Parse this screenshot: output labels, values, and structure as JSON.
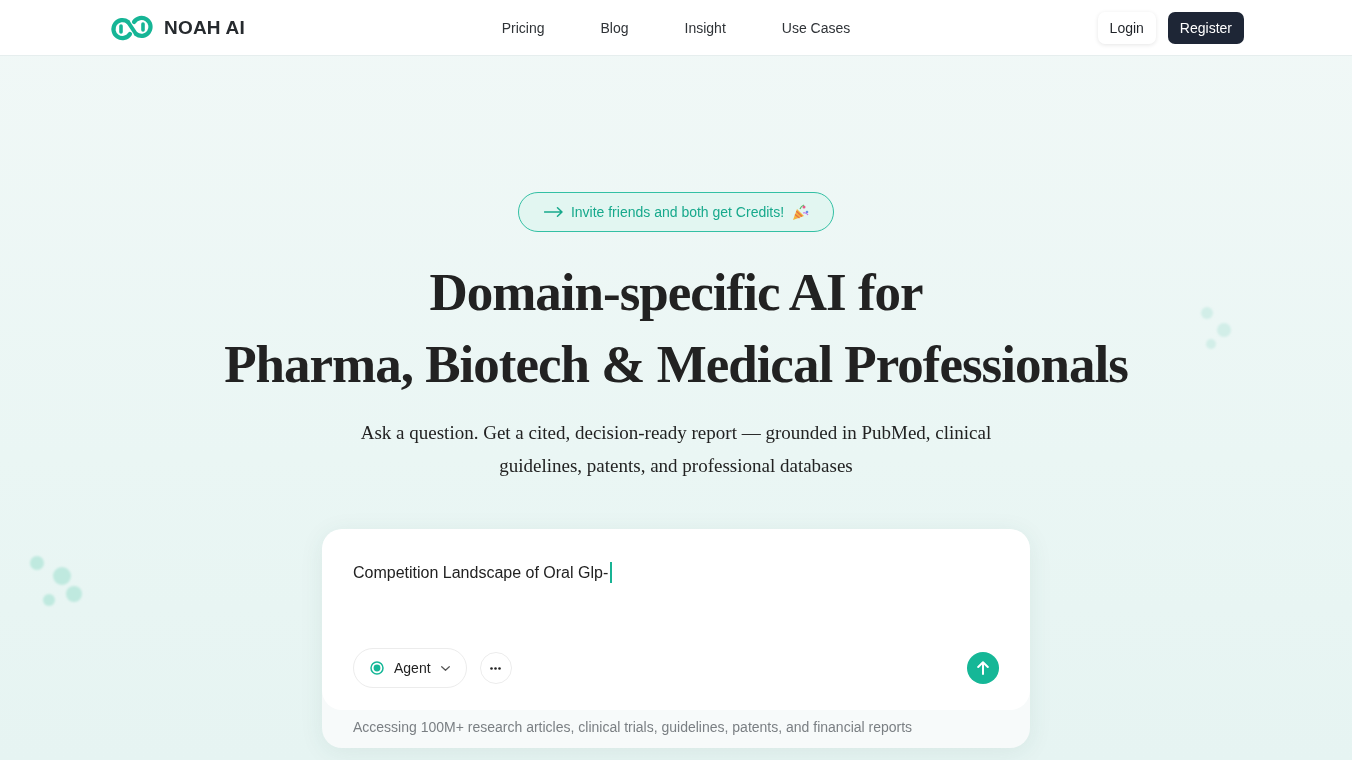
{
  "header": {
    "logo": {
      "text": "NOAH AI"
    },
    "nav": [
      {
        "label": "Pricing"
      },
      {
        "label": "Blog"
      },
      {
        "label": "Insight"
      },
      {
        "label": "Use Cases"
      }
    ],
    "login": "Login",
    "register": "Register"
  },
  "hero": {
    "invite_badge": "Invite friends and both get Credits!",
    "title_lines": [
      "Domain-specific AI for",
      "Pharma, Biotech & Medical Professionals"
    ],
    "subtitle": "Ask a question. Get a cited, decision-ready report — grounded in PubMed, clinical guidelines, patents, and professional databases"
  },
  "composer": {
    "value": "Competition Landscape of Oral Glp-",
    "mode": "Agent",
    "footer": "Accessing 100M+ research articles, clinical trials, guidelines, patents, and financial reports"
  }
}
